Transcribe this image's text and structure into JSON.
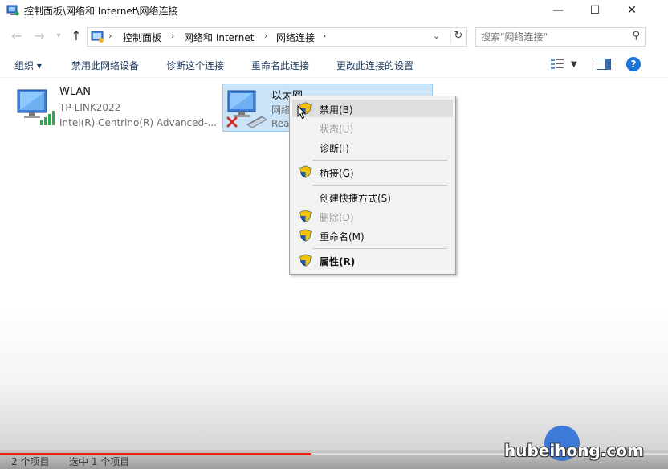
{
  "window": {
    "title": "控制面板\\网络和 Internet\\网络连接",
    "minimize": "—",
    "maximize": "☐",
    "close": "✕"
  },
  "address": {
    "breadcrumbs": [
      "控制面板",
      "网络和 Internet",
      "网络连接"
    ],
    "search_placeholder": "搜索\"网络连接\""
  },
  "toolbar": {
    "organize": "组织 ▾",
    "disable": "禁用此网络设备",
    "diagnose": "诊断这个连接",
    "rename": "重命名此连接",
    "change_settings": "更改此连接的设置",
    "help": "?"
  },
  "connections": [
    {
      "name": "WLAN",
      "network": "TP-LINK2022",
      "adapter": "Intel(R) Centrino(R) Advanced-...",
      "selected": false,
      "status": "connected"
    },
    {
      "name": "以太网",
      "network": "网络",
      "adapter": "Rea",
      "selected": true,
      "status": "disconnected"
    }
  ],
  "context_menu": {
    "items": [
      {
        "label": "禁用(B)",
        "shield": true,
        "disabled": false,
        "hover": true
      },
      {
        "label": "状态(U)",
        "shield": false,
        "disabled": true
      },
      {
        "label": "诊断(I)",
        "shield": false,
        "disabled": false
      },
      {
        "label": "桥接(G)",
        "shield": true,
        "disabled": false
      },
      {
        "label": "创建快捷方式(S)",
        "shield": false,
        "disabled": false
      },
      {
        "label": "删除(D)",
        "shield": true,
        "disabled": true
      },
      {
        "label": "重命名(M)",
        "shield": true,
        "disabled": false
      },
      {
        "label": "属性(R)",
        "shield": true,
        "disabled": false,
        "bold": true
      }
    ]
  },
  "statusbar": {
    "count": "2 个项目",
    "selected": "选中 1 个项目"
  },
  "video_progress": 0.465,
  "watermark": "hubeihong.com",
  "colors": {
    "accent": "#1a73d9",
    "selection": "#cce4f7",
    "progress": "#e62117",
    "disconnect": "#d32f2f"
  }
}
